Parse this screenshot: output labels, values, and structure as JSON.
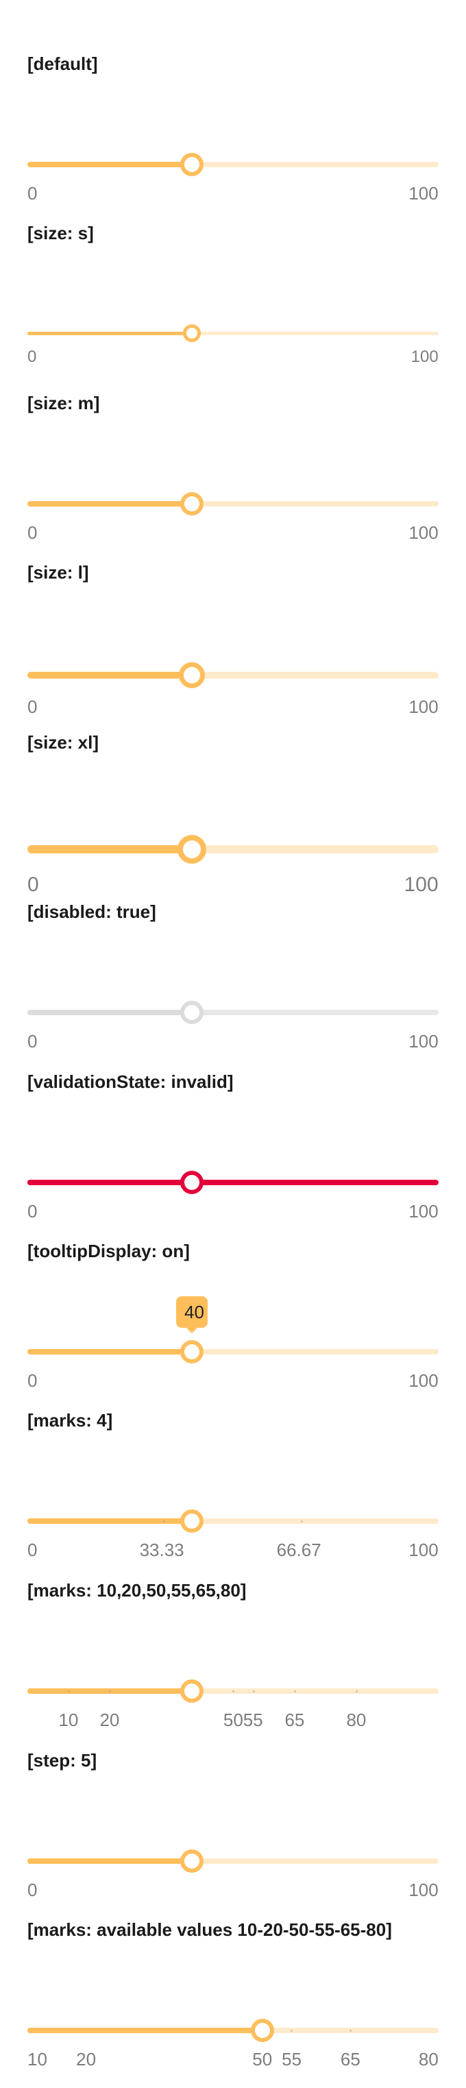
{
  "theme": {
    "accent": "#ffbe5c",
    "rail": "#ffebcc",
    "disabled": "#dcdcdc",
    "disabled_rail": "#e8e8e8",
    "invalid": "#e3003a",
    "label": "#7d7d7d"
  },
  "sections": [
    {
      "title": "[default]",
      "size": "m",
      "min": 0,
      "max": 100,
      "value": 40,
      "labels": [
        0,
        100
      ]
    },
    {
      "title": "[size: s]",
      "size": "s",
      "min": 0,
      "max": 100,
      "value": 40,
      "labels": [
        0,
        100
      ]
    },
    {
      "title": "[size: m]",
      "size": "m",
      "min": 0,
      "max": 100,
      "value": 40,
      "labels": [
        0,
        100
      ]
    },
    {
      "title": "[size: l]",
      "size": "l",
      "min": 0,
      "max": 100,
      "value": 40,
      "labels": [
        0,
        100
      ]
    },
    {
      "title": "[size: xl]",
      "size": "xl",
      "min": 0,
      "max": 100,
      "value": 40,
      "labels": [
        0,
        100
      ]
    },
    {
      "title": "[disabled: true]",
      "size": "m",
      "state": "disabled",
      "min": 0,
      "max": 100,
      "value": 40,
      "labels": [
        0,
        100
      ]
    },
    {
      "title": "[validationState: invalid]",
      "size": "m",
      "state": "invalid",
      "min": 0,
      "max": 100,
      "value": 40,
      "labels": [
        0,
        100
      ]
    },
    {
      "title": "[tooltipDisplay: on]",
      "size": "m",
      "min": 0,
      "max": 100,
      "value": 40,
      "labels": [
        0,
        100
      ],
      "tooltip": "40"
    },
    {
      "title": "[marks: 4]",
      "size": "m",
      "min": 0,
      "max": 100,
      "value": 40,
      "labels": [
        0,
        33.33,
        66.67,
        100
      ],
      "marks": [
        33.33,
        66.67
      ]
    },
    {
      "title": "[marks: 10,20,50,55,65,80]",
      "size": "m",
      "min": 0,
      "max": 100,
      "value": 40,
      "labels": [
        10,
        20,
        50,
        55,
        65,
        80
      ],
      "marks": [
        10,
        20,
        50,
        55,
        65,
        80
      ],
      "label_pairs": [
        [
          50,
          55,
          "5055"
        ]
      ]
    },
    {
      "title": "[step: 5]",
      "size": "m",
      "min": 0,
      "max": 100,
      "value": 40,
      "labels": [
        0,
        100
      ]
    },
    {
      "title": "[marks: available values 10-20-50-55-65-80]",
      "size": "m",
      "min": 10,
      "max": 80,
      "value": 50,
      "labels": [
        10,
        20,
        50,
        55,
        65,
        80
      ],
      "marks": [
        55,
        65
      ]
    }
  ]
}
